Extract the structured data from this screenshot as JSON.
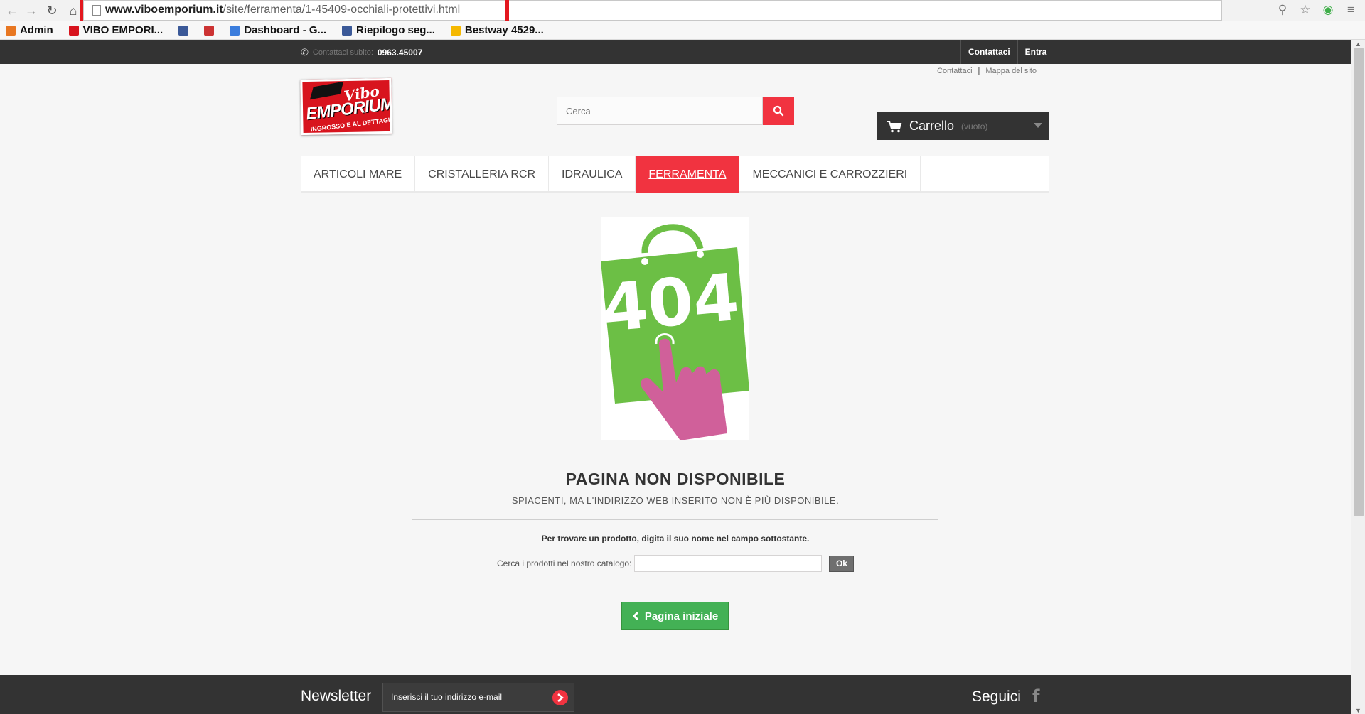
{
  "browser": {
    "url_domain": "www.viboemporium.it",
    "url_path": "/site/ferramenta/1-45409-occhiali-protettivi.html",
    "bookmarks": [
      {
        "label": "Admin",
        "color": "#e87722"
      },
      {
        "label": "VIBO EMPORI...",
        "color": "#d8141e"
      },
      {
        "label": "",
        "color": "#3b5998"
      },
      {
        "label": "",
        "color": "#cc3333"
      },
      {
        "label": "Dashboard - G...",
        "color": "#3b7ddd"
      },
      {
        "label": "Riepilogo seg...",
        "color": "#3b5998"
      },
      {
        "label": "Bestway 4529...",
        "color": "#f5b800"
      }
    ]
  },
  "topbar": {
    "phone_label": "Contattaci subito:",
    "phone_number": "0963.45007",
    "links": [
      "Contattaci",
      "Entra"
    ]
  },
  "sublinks": [
    "Contattaci",
    "Mappa del sito"
  ],
  "logo": {
    "line1": "Vibo",
    "line2": "EMPORIUM",
    "line3": "INGROSSO E AL DETTAGLIO"
  },
  "search": {
    "placeholder": "Cerca"
  },
  "cart": {
    "label": "Carrello",
    "status": "(vuoto)"
  },
  "menu": {
    "items": [
      "Articoli mare",
      "Cristalleria RCR",
      "Idraulica",
      "Ferramenta",
      "Meccanici e Carrozzieri"
    ],
    "active_index": 3
  },
  "error": {
    "code": "404",
    "title": "PAGINA NON DISPONIBILE",
    "subtitle": "Spiacenti, ma l'indirizzo web inserito non è più disponibile.",
    "hint": "Per trovare un prodotto, digita il suo nome nel campo sottostante.",
    "catalog_label": "Cerca i prodotti nel nostro catalogo:",
    "ok_label": "Ok",
    "home_label": "Pagina iniziale"
  },
  "footer": {
    "newsletter_title": "Newsletter",
    "newsletter_placeholder": "Inserisci il tuo indirizzo e-mail",
    "social_title": "Seguici"
  },
  "colors": {
    "accent": "#f13340",
    "dark": "#333333",
    "green": "#43b155",
    "bag_green": "#6cbf45",
    "hand_pink": "#d0609a"
  }
}
